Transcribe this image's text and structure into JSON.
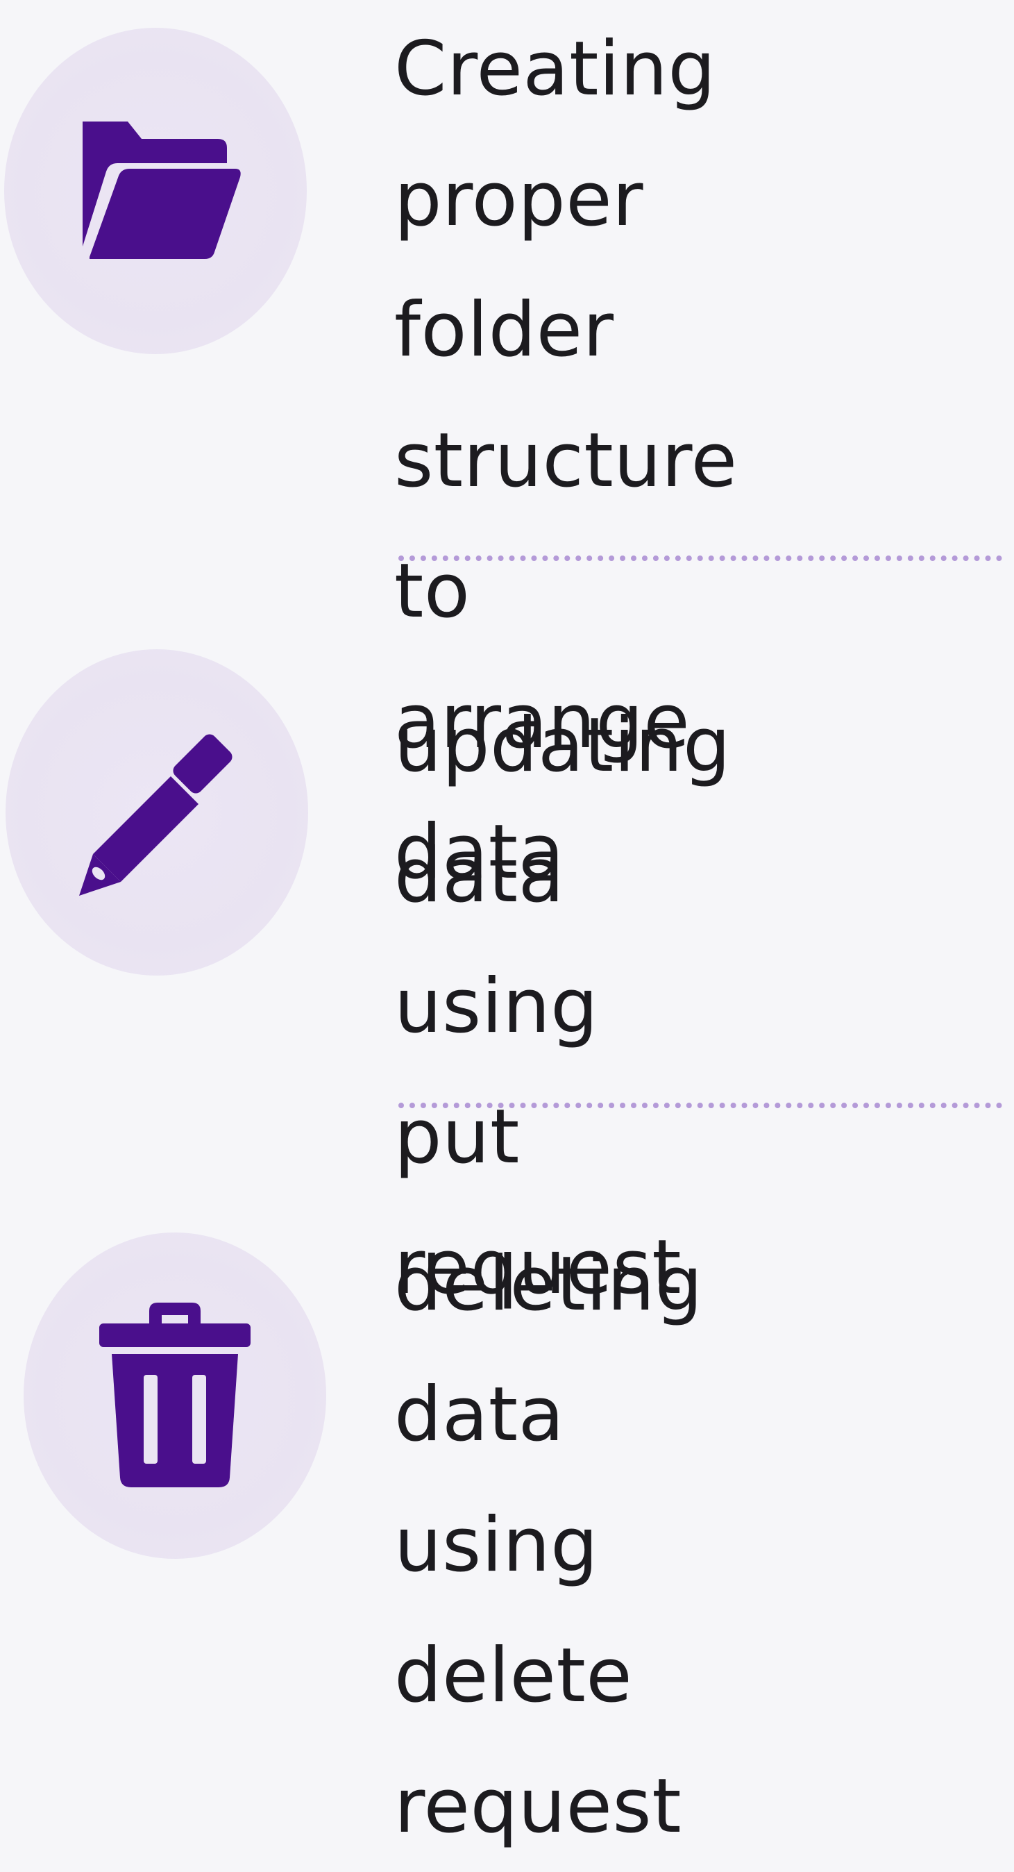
{
  "colors": {
    "background": "#f6f6f9",
    "icon_circle": "#ebe5f3",
    "icon_fill": "#4a0f8c",
    "text": "#1c1b1f",
    "divider": "#b49ad8"
  },
  "features": [
    {
      "icon": "folder-icon",
      "text": "Creating proper\nfolder structure\nto arrange data"
    },
    {
      "icon": "pencil-icon",
      "text": "updating data\nusing put request"
    },
    {
      "icon": "trash-icon",
      "text": "deleting data\nusing delete\nrequest"
    }
  ]
}
